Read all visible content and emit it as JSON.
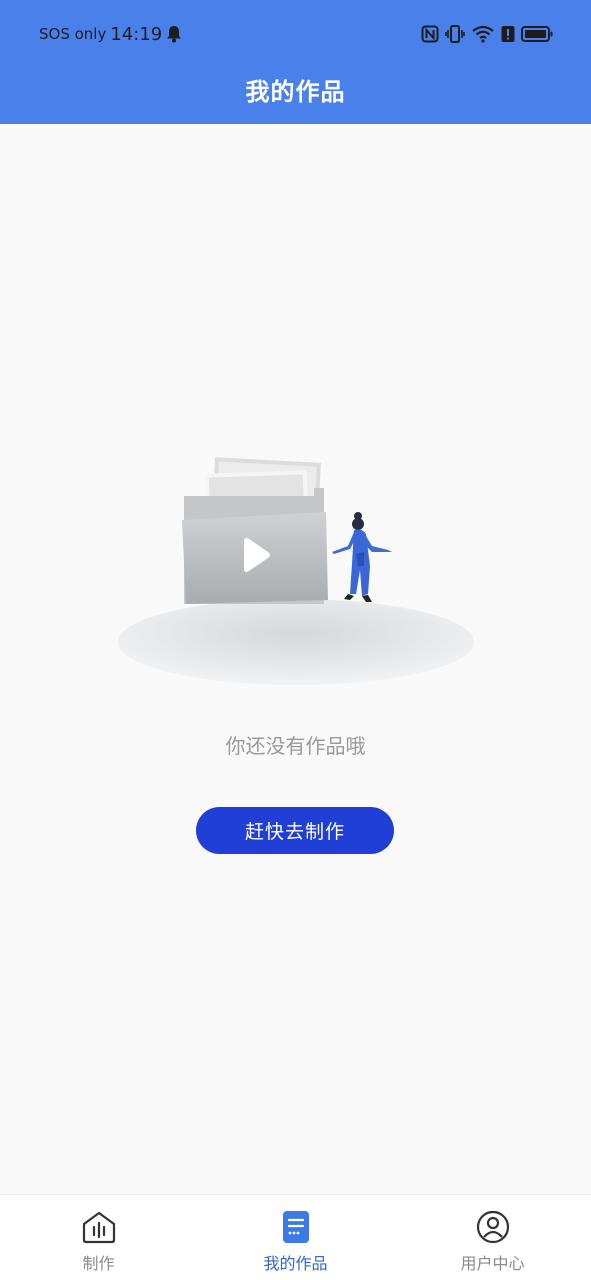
{
  "status_bar": {
    "carrier": "SOS only",
    "time": "14:19",
    "icons": [
      "bell-icon",
      "nfc-icon",
      "vibrate-icon",
      "wifi-icon",
      "alert-icon",
      "battery-icon"
    ]
  },
  "header": {
    "title": "我的作品",
    "background_color": "#4a80ea"
  },
  "empty_state": {
    "message": "你还没有作品哦",
    "cta_label": "赶快去制作",
    "cta_color": "#1f3fd6"
  },
  "bottom_nav": {
    "items": [
      {
        "label": "制作",
        "icon": "home-chart-icon",
        "active": false
      },
      {
        "label": "我的作品",
        "icon": "document-list-icon",
        "active": true
      },
      {
        "label": "用户中心",
        "icon": "user-circle-icon",
        "active": false
      }
    ],
    "active_color": "#2f67d8"
  }
}
